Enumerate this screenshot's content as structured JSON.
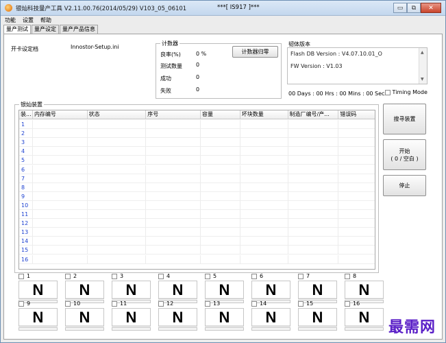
{
  "window": {
    "title": "银灿科技量产工具 V2.11.00.76(2014/05/29)   V103_05_06101",
    "center_title": "***[ IS917 ]***",
    "min_label": "▭",
    "max_label": "⧉",
    "close_label": "✕"
  },
  "menu": [
    "功能",
    "设置",
    "帮助"
  ],
  "tabs": [
    "量产测试",
    "量产设定",
    "量产产品信息"
  ],
  "left": {
    "open_card_label": "开卡设定档",
    "open_card_value": "Innostor-Setup.ini"
  },
  "counter": {
    "title": "计数器",
    "rows": [
      {
        "label": "良率(%)",
        "value": "0 %"
      },
      {
        "label": "测试数量",
        "value": "0"
      },
      {
        "label": "成功",
        "value": "0"
      },
      {
        "label": "失败",
        "value": "0"
      }
    ],
    "reset_button": "计数器归零"
  },
  "firmware": {
    "title": "韧体版本",
    "flash_db": "Flash DB Version :  V4.07.10.01_O",
    "fw": "FW Version :  V1.03"
  },
  "timer": {
    "text": "00 Days : 00 Hrs : 00 Mins : 00 Secs",
    "timing_mode": "Timing Mode"
  },
  "device_group": {
    "title": "银灿装置"
  },
  "table": {
    "columns": [
      "装...",
      "内存编号",
      "状态",
      "序号",
      "容量",
      "坏块数量",
      "制造厂编号/产...",
      "错误码"
    ],
    "rows": [
      "1",
      "2",
      "3",
      "4",
      "5",
      "6",
      "7",
      "8",
      "9",
      "10",
      "11",
      "12",
      "13",
      "14",
      "15",
      "16"
    ]
  },
  "buttons": {
    "search": "搜寻装置",
    "start_line1": "开始",
    "start_line2": "( 0 / 空白 )",
    "stop": "停止"
  },
  "slots": [
    {
      "num": "1",
      "state": "N"
    },
    {
      "num": "2",
      "state": "N"
    },
    {
      "num": "3",
      "state": "N"
    },
    {
      "num": "4",
      "state": "N"
    },
    {
      "num": "5",
      "state": "N"
    },
    {
      "num": "6",
      "state": "N"
    },
    {
      "num": "7",
      "state": "N"
    },
    {
      "num": "8",
      "state": "N"
    },
    {
      "num": "9",
      "state": "N"
    },
    {
      "num": "10",
      "state": "N"
    },
    {
      "num": "11",
      "state": "N"
    },
    {
      "num": "12",
      "state": "N"
    },
    {
      "num": "13",
      "state": "N"
    },
    {
      "num": "14",
      "state": "N"
    },
    {
      "num": "15",
      "state": "N"
    },
    {
      "num": "16",
      "state": "N"
    }
  ],
  "watermark": "最需网"
}
